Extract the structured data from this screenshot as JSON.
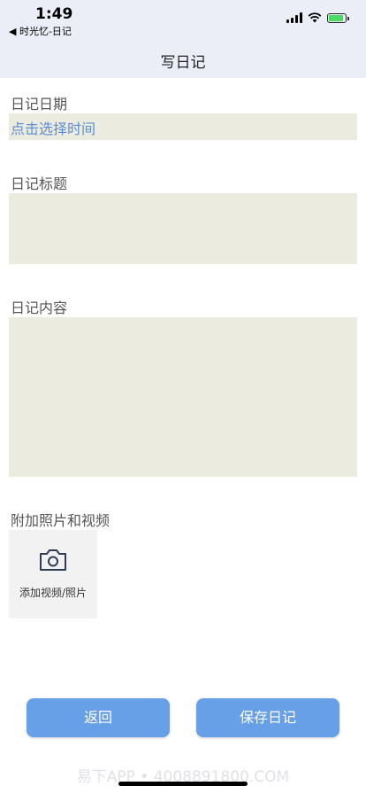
{
  "status": {
    "time": "1:49",
    "back_app": "◀ 时光忆-日记",
    "battery_color": "#4cd964"
  },
  "nav": {
    "title": "写日记"
  },
  "form": {
    "date_label": "日记日期",
    "date_value": "点击选择时间",
    "title_label": "日记标题",
    "title_value": "",
    "content_label": "日记内容",
    "content_value": "",
    "media_label": "附加照片和视频",
    "media_button": "添加视频/照片"
  },
  "actions": {
    "back": "返回",
    "save": "保存日记"
  },
  "watermark": "易下APP • 4008891800.COM",
  "colors": {
    "field_bg": "#ecebdf",
    "accent": "#67a0e6",
    "link": "#5b8fd4",
    "bar_bg": "#eceef7"
  },
  "icons": {
    "camera": "camera-icon",
    "wifi": "wifi-icon",
    "signal": "signal-icon",
    "battery": "battery-icon"
  }
}
